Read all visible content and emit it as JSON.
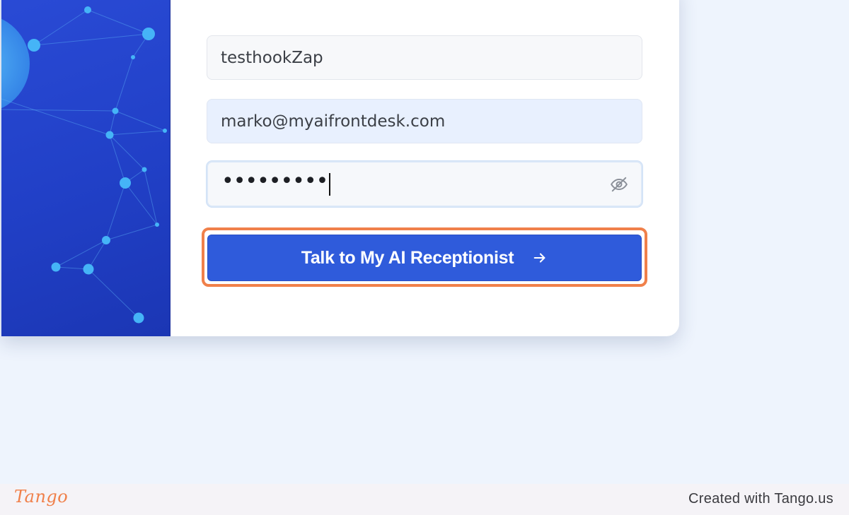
{
  "form": {
    "name_value": "testhookZap",
    "email_value": "marko@myaifrontdesk.com",
    "password_masked": "•••••••••"
  },
  "icons": {
    "password_toggle": "eye-off-icon",
    "submit_arrow": "arrow-right-icon"
  },
  "submit": {
    "label": "Talk to My AI Receptionist"
  },
  "footer": {
    "logo_text": "Tango",
    "credit": "Created with Tango.us"
  },
  "colors": {
    "primary_button": "#2f5bdb",
    "highlight": "#f0804a",
    "hero_panel": "#2140c7",
    "background": "#eef4fd"
  }
}
